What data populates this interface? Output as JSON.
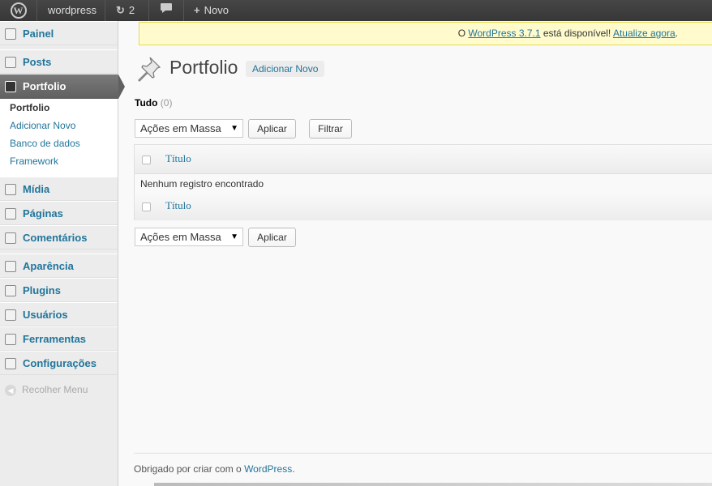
{
  "adminbar": {
    "wp_logo": "W",
    "site_name": "wordpress",
    "updates_count": "2",
    "new_label": "Novo"
  },
  "sidemenu": {
    "items": [
      {
        "label": "Painel",
        "icon": "home-icon"
      },
      {
        "label": "Posts",
        "icon": "pin-icon"
      },
      {
        "label": "Portfolio",
        "icon": "briefcase-icon"
      },
      {
        "label": "Mídia",
        "icon": "media-icon"
      },
      {
        "label": "Páginas",
        "icon": "pages-icon"
      },
      {
        "label": "Comentários",
        "icon": "comments-icon"
      },
      {
        "label": "Aparência",
        "icon": "appearance-icon"
      },
      {
        "label": "Plugins",
        "icon": "plugins-icon"
      },
      {
        "label": "Usuários",
        "icon": "users-icon"
      },
      {
        "label": "Ferramentas",
        "icon": "tools-icon"
      },
      {
        "label": "Configurações",
        "icon": "settings-icon"
      }
    ],
    "submenu": [
      "Portfolio",
      "Adicionar Novo",
      "Banco de dados",
      "Framework"
    ],
    "collapse_label": "Recolher Menu"
  },
  "notice": {
    "prefix": "O ",
    "link_version": "WordPress 3.7.1",
    "middle": " está disponível! ",
    "link_update": "Atualize agora",
    "suffix": "."
  },
  "page": {
    "title": "Portfolio",
    "add_new": "Adicionar Novo",
    "filter_all": "Tudo",
    "filter_count": "(0)"
  },
  "toolbar": {
    "bulk_actions": "Ações em Massa",
    "apply": "Aplicar",
    "filter": "Filtrar"
  },
  "table": {
    "column_title": "Título",
    "no_items": "Nenhum registro encontrado"
  },
  "footer": {
    "text": "Obrigado por criar com o ",
    "link": "WordPress",
    "suffix": "."
  },
  "colors": {
    "link": "#21759b",
    "active_menu": "#6d6d6d",
    "notice_bg": "#fffbcc"
  }
}
